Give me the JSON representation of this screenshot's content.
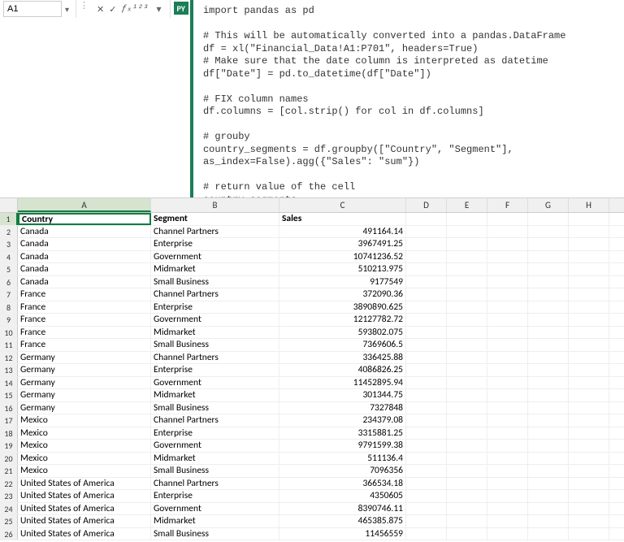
{
  "name_box": "A1",
  "py_badge": "PY",
  "code": "import pandas as pd\n\n# This will be automatically converted into a pandas.DataFrame\ndf = xl(\"Financial_Data!A1:P701\", headers=True)\n# Make sure that the date column is interpreted as datetime\ndf[\"Date\"] = pd.to_datetime(df[\"Date\"])\n\n# FIX column names\ndf.columns = [col.strip() for col in df.columns]\n\n# grouby\ncountry_segments = df.groupby([\"Country\", \"Segment\"], as_index=False).agg({\"Sales\": \"sum\"})\n\n# return value of the cell\ncountry_segments",
  "columns": [
    "A",
    "B",
    "C",
    "D",
    "E",
    "F",
    "G",
    "H"
  ],
  "headers": {
    "A": "Country",
    "B": "Segment",
    "C": "Sales"
  },
  "rows": [
    {
      "n": 1,
      "A": "Country",
      "B": "Segment",
      "C": "Sales",
      "header": true
    },
    {
      "n": 2,
      "A": "Canada",
      "B": "Channel Partners",
      "C": "491164.14"
    },
    {
      "n": 3,
      "A": "Canada",
      "B": "Enterprise",
      "C": "3967491.25"
    },
    {
      "n": 4,
      "A": "Canada",
      "B": "Government",
      "C": "10741236.52"
    },
    {
      "n": 5,
      "A": "Canada",
      "B": "Midmarket",
      "C": "510213.975"
    },
    {
      "n": 6,
      "A": "Canada",
      "B": "Small Business",
      "C": "9177549"
    },
    {
      "n": 7,
      "A": "France",
      "B": "Channel Partners",
      "C": "372090.36"
    },
    {
      "n": 8,
      "A": "France",
      "B": "Enterprise",
      "C": "3890890.625"
    },
    {
      "n": 9,
      "A": "France",
      "B": "Government",
      "C": "12127782.72"
    },
    {
      "n": 10,
      "A": "France",
      "B": "Midmarket",
      "C": "593802.075"
    },
    {
      "n": 11,
      "A": "France",
      "B": "Small Business",
      "C": "7369606.5"
    },
    {
      "n": 12,
      "A": "Germany",
      "B": "Channel Partners",
      "C": "336425.88"
    },
    {
      "n": 13,
      "A": "Germany",
      "B": "Enterprise",
      "C": "4086826.25"
    },
    {
      "n": 14,
      "A": "Germany",
      "B": "Government",
      "C": "11452895.94"
    },
    {
      "n": 15,
      "A": "Germany",
      "B": "Midmarket",
      "C": "301344.75"
    },
    {
      "n": 16,
      "A": "Germany",
      "B": "Small Business",
      "C": "7327848"
    },
    {
      "n": 17,
      "A": "Mexico",
      "B": "Channel Partners",
      "C": "234379.08"
    },
    {
      "n": 18,
      "A": "Mexico",
      "B": "Enterprise",
      "C": "3315881.25"
    },
    {
      "n": 19,
      "A": "Mexico",
      "B": "Government",
      "C": "9791599.38"
    },
    {
      "n": 20,
      "A": "Mexico",
      "B": "Midmarket",
      "C": "511136.4"
    },
    {
      "n": 21,
      "A": "Mexico",
      "B": "Small Business",
      "C": "7096356"
    },
    {
      "n": 22,
      "A": "United States of America",
      "B": "Channel Partners",
      "C": "366534.18"
    },
    {
      "n": 23,
      "A": "United States of America",
      "B": "Enterprise",
      "C": "4350605"
    },
    {
      "n": 24,
      "A": "United States of America",
      "B": "Government",
      "C": "8390746.11"
    },
    {
      "n": 25,
      "A": "United States of America",
      "B": "Midmarket",
      "C": "465385.875"
    },
    {
      "n": 26,
      "A": "United States of America",
      "B": "Small Business",
      "C": "11456559"
    }
  ],
  "active_cell": "A1",
  "fb_fx_label": "ƒₓ¹²³"
}
